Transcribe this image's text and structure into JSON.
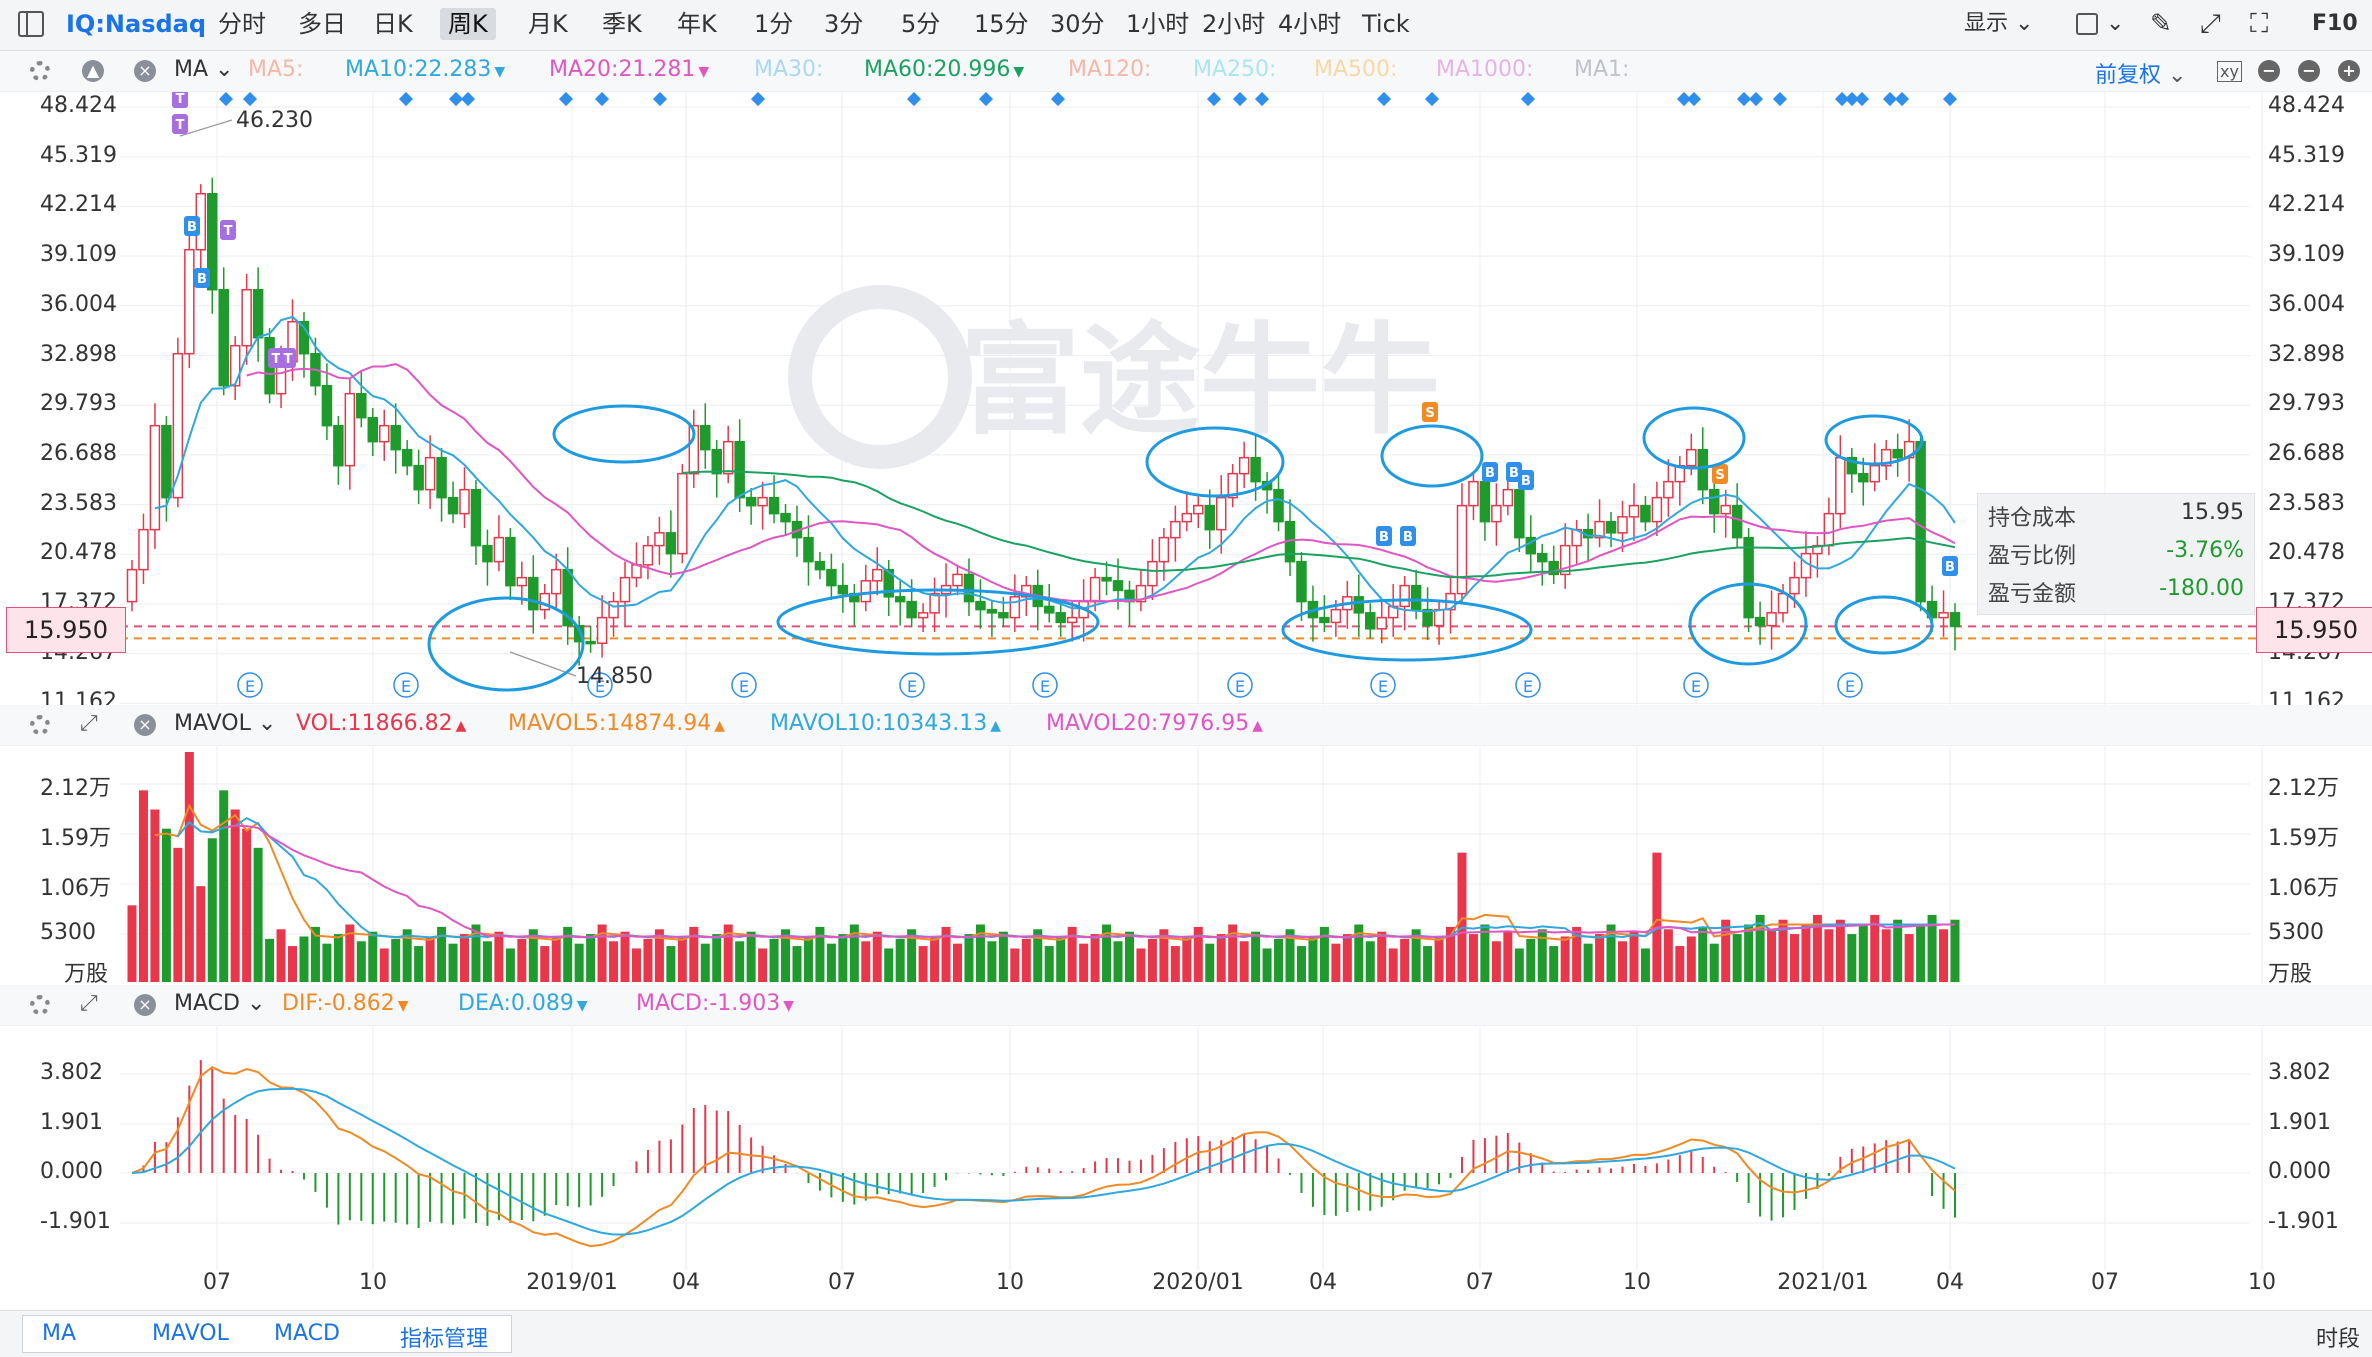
{
  "toolbar": {
    "symbol": "IQ:Nasdaq",
    "periods": [
      "分时",
      "多日",
      "日K",
      "周K",
      "月K",
      "季K",
      "年K",
      "1分",
      "3分",
      "5分",
      "15分",
      "30分",
      "1小时",
      "2小时",
      "4小时",
      "Tick"
    ],
    "active_period": "周K",
    "display_label": "显示",
    "f10_label": "F10"
  },
  "ma_bar": {
    "name": "MA",
    "items": [
      {
        "label": "MA5:",
        "color": "#f7b6a6"
      },
      {
        "label": "MA10:22.283",
        "color": "#2fa8e0",
        "arrow": "▼"
      },
      {
        "label": "MA20:21.281",
        "color": "#e056c4",
        "arrow": "▼"
      },
      {
        "label": "MA30:",
        "color": "#a9d9f3"
      },
      {
        "label": "MA60:20.996",
        "color": "#1aa260",
        "arrow": "▼"
      },
      {
        "label": "MA120:",
        "color": "#f7b6a6"
      },
      {
        "label": "MA250:",
        "color": "#a8e6f0"
      },
      {
        "label": "MA500:",
        "color": "#f9d8a3"
      },
      {
        "label": "MA1000:",
        "color": "#e6b3e6"
      },
      {
        "label": "MA1:",
        "color": "#bfc3c9"
      }
    ],
    "adjust_label": "前复权"
  },
  "price_axis": {
    "ticks": [
      "48.424",
      "45.319",
      "42.214",
      "39.109",
      "36.004",
      "32.898",
      "29.793",
      "26.688",
      "23.583",
      "20.478",
      "17.372",
      "14.267",
      "11.162"
    ],
    "current_price": "15.950",
    "high_marker": "46.230",
    "low_marker": "14.850"
  },
  "position_info": {
    "cost_label": "持仓成本",
    "cost_value": "15.95",
    "ratio_label": "盈亏比例",
    "ratio_value": "-3.76%",
    "amount_label": "盈亏金额",
    "amount_value": "-180.00"
  },
  "vol_bar": {
    "name": "MAVOL",
    "items": [
      {
        "label": "VOL:11866.82",
        "color": "#e8364b",
        "arrow": "▲"
      },
      {
        "label": "MAVOL5:14874.94",
        "color": "#f08a24",
        "arrow": "▲"
      },
      {
        "label": "MAVOL10:10343.13",
        "color": "#2fa8e0",
        "arrow": "▲"
      },
      {
        "label": "MAVOL20:7976.95",
        "color": "#e056c4",
        "arrow": "▲"
      }
    ]
  },
  "vol_axis": {
    "ticks": [
      "2.12万",
      "1.59万",
      "1.06万",
      "5300"
    ],
    "unit": "万股"
  },
  "macd_bar": {
    "name": "MACD",
    "items": [
      {
        "label": "DIF:-0.862",
        "color": "#f08a24",
        "arrow": "▼"
      },
      {
        "label": "DEA:0.089",
        "color": "#2fa8e0",
        "arrow": "▼"
      },
      {
        "label": "MACD:-1.903",
        "color": "#e056c4",
        "arrow": "▼"
      }
    ]
  },
  "macd_axis": {
    "ticks": [
      "3.802",
      "1.901",
      "0.000",
      "-1.901"
    ]
  },
  "time_axis": {
    "labels": [
      "07",
      "10",
      "2019/01",
      "04",
      "07",
      "10",
      "2020/01",
      "04",
      "07",
      "10",
      "2021/01",
      "04",
      "07",
      "10"
    ],
    "period_label": "时段"
  },
  "bottom_tabs": [
    "MA",
    "MAVOL",
    "MACD",
    "指标管理"
  ],
  "watermark": "富途牛牛",
  "colors": {
    "up": "#e8364b",
    "down": "#1f9a2c",
    "accent": "#1a73e8",
    "circle": "#1e9ae0"
  },
  "chart_data": [
    {
      "type": "candlestick",
      "title": "IQ:Nasdaq 周K",
      "x_ticks": [
        "07",
        "10",
        "2019/01",
        "04",
        "07",
        "10",
        "2020/01",
        "04",
        "07",
        "10",
        "2021/01",
        "04"
      ],
      "ylim": [
        11.162,
        48.424
      ],
      "y_ticks": [
        48.424,
        45.319,
        42.214,
        39.109,
        36.004,
        32.898,
        29.793,
        26.688,
        23.583,
        20.478,
        17.372,
        14.267,
        11.162
      ],
      "close": [
        19.5,
        22.0,
        28.5,
        24.0,
        33.0,
        39.5,
        43.0,
        37.0,
        31.0,
        33.5,
        37.0,
        34.0,
        30.5,
        32.5,
        35.0,
        33.0,
        31.0,
        28.5,
        26.0,
        30.5,
        29.0,
        27.5,
        28.5,
        27.0,
        26.0,
        24.5,
        26.5,
        24.0,
        23.0,
        24.5,
        21.0,
        20.0,
        21.5,
        18.5,
        19.0,
        17.0,
        18.0,
        19.5,
        16.0,
        15.0,
        14.9,
        16.5,
        17.5,
        19.0,
        19.8,
        21.0,
        21.8,
        20.5,
        25.5,
        28.5,
        27.0,
        25.5,
        27.5,
        24.0,
        23.5,
        24.0,
        23.0,
        22.5,
        21.5,
        20.0,
        19.5,
        18.5,
        18.0,
        17.5,
        18.8,
        19.5,
        17.8,
        17.5,
        16.5,
        16.8,
        18.0,
        18.5,
        19.2,
        17.5,
        17.0,
        16.8,
        16.5,
        17.8,
        18.5,
        17.2,
        16.8,
        16.2,
        16.5,
        17.5,
        19.0,
        18.8,
        18.2,
        17.5,
        18.5,
        20.0,
        21.5,
        22.5,
        23.0,
        23.5,
        22.0,
        24.0,
        25.5,
        26.5,
        25.0,
        24.5,
        22.5,
        20.0,
        17.5,
        16.5,
        16.2,
        17.0,
        17.8,
        16.8,
        15.8,
        16.5,
        17.2,
        18.5,
        17.0,
        16.0,
        17.0,
        18.0,
        23.5,
        25.0,
        22.5,
        23.5,
        24.5,
        21.5,
        20.5,
        20.0,
        19.2,
        21.0,
        22.0,
        21.5,
        22.5,
        21.8,
        22.8,
        23.5,
        22.5,
        24.0,
        25.0,
        26.0,
        27.0,
        24.5,
        23.0,
        23.5,
        21.5,
        16.5,
        16.0,
        16.8,
        18.0,
        19.0,
        20.5,
        21.0,
        23.0,
        26.5,
        25.5,
        25.0,
        26.0,
        27.0,
        26.5,
        27.5,
        17.5,
        16.5,
        16.8,
        15.95
      ],
      "volume_unit": "万股",
      "volume_ylim": [
        0,
        2.4
      ],
      "vol_ticks": [
        "2.12万",
        "1.59万",
        "1.06万",
        "5300"
      ]
    },
    {
      "type": "bar",
      "title": "MACD",
      "ylim": [
        -2.2,
        4.5
      ],
      "y_ticks": [
        3.802,
        1.901,
        0.0,
        -1.901
      ],
      "series": [
        {
          "name": "DIF",
          "last": -0.862
        },
        {
          "name": "DEA",
          "last": 0.089
        },
        {
          "name": "MACD",
          "last": -1.903
        }
      ]
    }
  ]
}
